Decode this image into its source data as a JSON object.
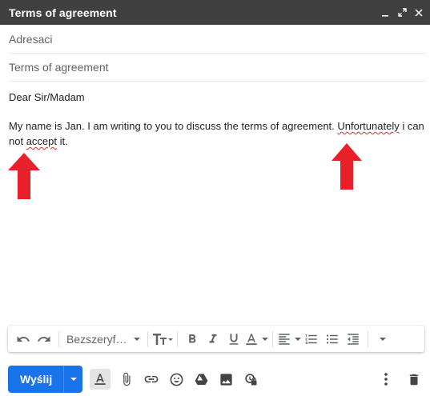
{
  "window": {
    "title": "Terms of agreement",
    "controls": [
      "minimize-icon",
      "expand-icon",
      "close-icon"
    ]
  },
  "compose": {
    "to_placeholder": "Adresaci",
    "subject_value": "Terms of agreement",
    "body": {
      "greeting": "Dear Sir/Madam",
      "text_before": "My name is Jan. I am writing to you to discuss the terms of agreement. ",
      "misspelled_1": "Unfortunately",
      "text_middle": " i can not ",
      "misspelled_2": "accept",
      "text_after": " it."
    }
  },
  "annotations": {
    "arrow_color": "#e8202a",
    "arrows": [
      "arrow-under-accept",
      "arrow-under-unfortunately"
    ]
  },
  "format_toolbar": {
    "font_family": "Bezszeryf…",
    "icons": [
      "undo-icon",
      "redo-icon",
      "font-size-icon",
      "bold-icon",
      "italic-icon",
      "underline-icon",
      "text-color-icon",
      "align-icon",
      "numbered-list-icon",
      "bulleted-list-icon",
      "indent-less-icon",
      "more-formatting-icon"
    ]
  },
  "bottom_bar": {
    "send_label": "Wyślij",
    "send_color": "#1a73e8",
    "icons": [
      "formatting-options-icon",
      "attach-icon",
      "insert-link-icon",
      "emoji-icon",
      "drive-icon",
      "insert-photo-icon",
      "confidential-mode-icon",
      "more-options-icon",
      "discard-icon"
    ]
  }
}
